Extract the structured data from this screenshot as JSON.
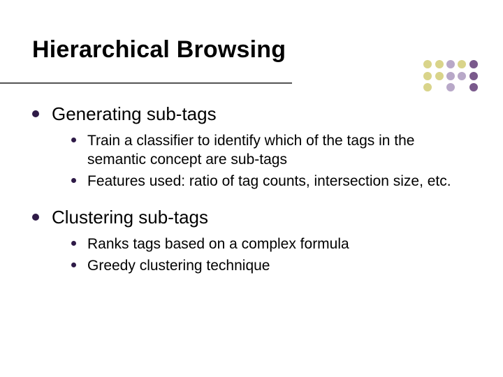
{
  "title": "Hierarchical Browsing",
  "sections": [
    {
      "heading": "Generating sub-tags",
      "items": [
        "Train a classifier to identify which of the tags in the semantic concept are sub-tags",
        "Features used: ratio of tag counts, intersection size, etc."
      ]
    },
    {
      "heading": "Clustering sub-tags",
      "items": [
        "Ranks tags based on a complex formula",
        "Greedy clustering technique"
      ]
    }
  ],
  "decoration": {
    "rows": [
      [
        "#d9d48a",
        "#d9d48a",
        "#b8a8c8",
        "#d9d48a",
        "#7a5a8c"
      ],
      [
        "#d9d48a",
        "#d9d48a",
        "#b8a8c8",
        "#b8a8c8",
        "#7a5a8c"
      ],
      [
        "#d9d48a",
        "transparent",
        "#b8a8c8",
        "transparent",
        "#7a5a8c"
      ]
    ]
  }
}
